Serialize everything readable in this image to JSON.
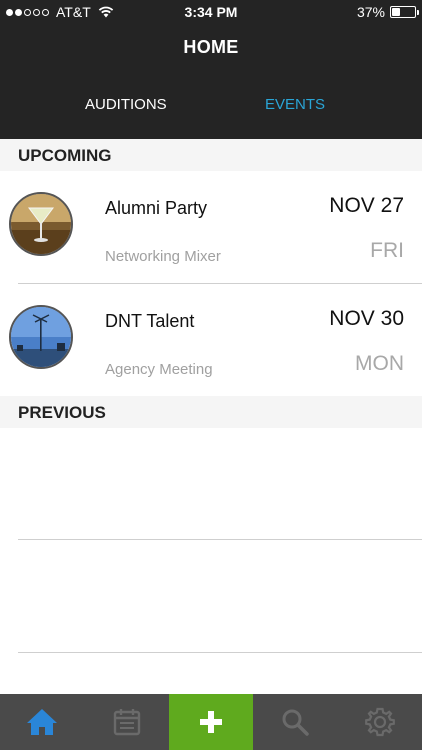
{
  "status_bar": {
    "carrier": "AT&T",
    "time": "3:34 PM",
    "battery": "37%",
    "battery_level": 0.37
  },
  "nav": {
    "title": "HOME"
  },
  "tabs": [
    {
      "label": "AUDITIONS",
      "active": false
    },
    {
      "label": "EVENTS",
      "active": true
    }
  ],
  "colors": {
    "accent": "#2aa5d6",
    "add_button": "#5faa1e",
    "header_bg": "#242424",
    "tabbar_bg": "#4a4a4a"
  },
  "sections": {
    "upcoming": "UPCOMING",
    "previous": "PREVIOUS"
  },
  "events": [
    {
      "title": "Alumni Party",
      "subtitle": "Networking Mixer",
      "date": "NOV 27",
      "day": "FRI"
    },
    {
      "title": "DNT Talent",
      "subtitle": "Agency Meeting",
      "date": "NOV 30",
      "day": "MON"
    }
  ],
  "tabbar": [
    {
      "icon": "home-icon",
      "active": true
    },
    {
      "icon": "calendar-icon",
      "active": false
    },
    {
      "icon": "plus-icon",
      "active": false
    },
    {
      "icon": "search-icon",
      "active": false
    },
    {
      "icon": "gear-icon",
      "active": false
    }
  ]
}
